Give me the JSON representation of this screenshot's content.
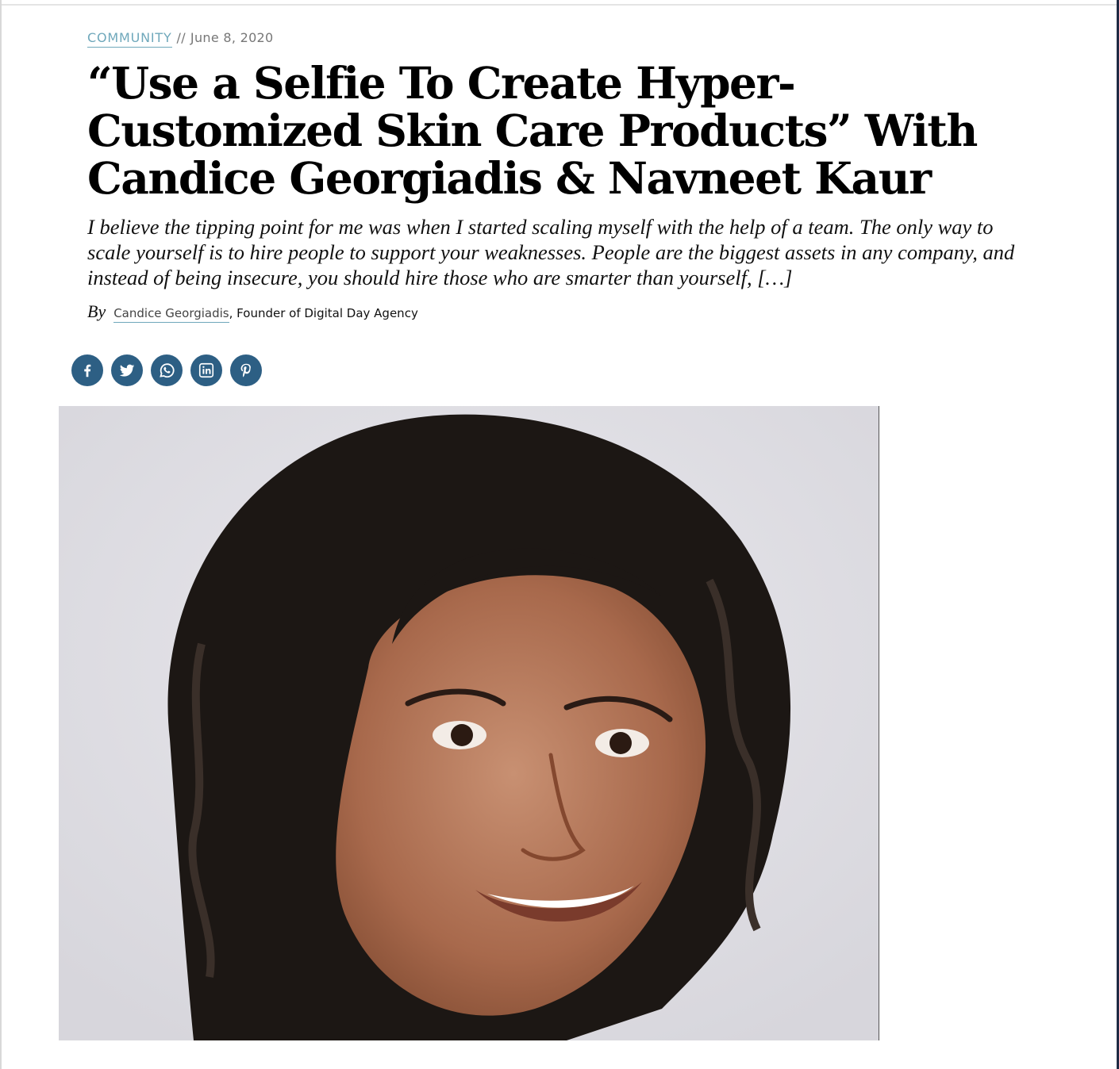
{
  "meta": {
    "category": "COMMUNITY",
    "separator": "//",
    "date": "June 8, 2020"
  },
  "article": {
    "headline": "“Use a Selfie To Create Hyper-Customized Skin Care Products” With Candice Georgiadis & Navneet Kaur",
    "excerpt": "I believe the tipping point for me was when I started scaling myself with the help of a team. The only way to scale yourself is to hire people to support your weaknesses. People are the biggest assets in any company, and instead of being insecure, you should hire those who are smarter than yourself, […]"
  },
  "byline": {
    "by_label": "By",
    "author": "Candice Georgiadis",
    "role": ", Founder of Digital Day Agency"
  },
  "share": {
    "icons": [
      "facebook-icon",
      "twitter-icon",
      "whatsapp-icon",
      "linkedin-icon",
      "pinterest-icon"
    ],
    "color": "#2d5f84"
  },
  "colors": {
    "link_accent": "#6fa8bb",
    "headline": "#000000",
    "image_background": "#dedde3"
  }
}
